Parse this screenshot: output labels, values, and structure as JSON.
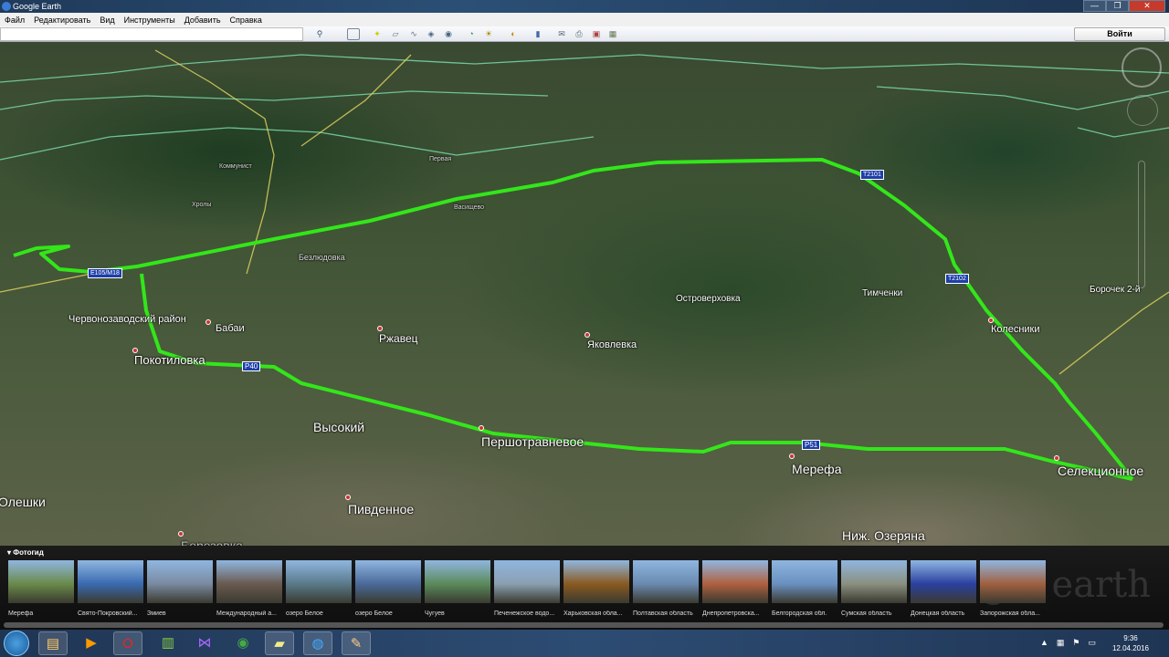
{
  "window": {
    "title": "Google Earth",
    "min": "—",
    "max": "❐",
    "close": "✕"
  },
  "menu": [
    "Файл",
    "Редактировать",
    "Вид",
    "Инструменты",
    "Добавить",
    "Справка"
  ],
  "toolbar": {
    "search_value": "",
    "login": "Войти"
  },
  "map": {
    "route_color": "#33e61a",
    "places": {
      "chervonozavodsky": "Червонозаводский район",
      "babai": "Бабаи",
      "bezlyudovka": "Безлюдовка",
      "pokotilovka": "Покотиловка",
      "rzhavets": "Ржавец",
      "vysokiy": "Высокий",
      "pershotravnevoe": "Першотравневое",
      "pivdennoe": "Пивденное",
      "merefa": "Мерефа",
      "nizh_ozeryana": "Ниж. Озеряна",
      "selektsionnoe": "Селекционное",
      "yakovlevka": "Яковлевка",
      "ostroverkhovka": "Островерховка",
      "timchenki": "Тимченки",
      "kolesniki": "Колесники",
      "borochek": "Борочек 2-й",
      "oleshki": "Олешки",
      "berezovka": "Березовка",
      "vasischevo": "Васищево",
      "khroly": "Хролы",
      "kommunist": "Коммунист",
      "pervaya": "Первая"
    },
    "roads": {
      "r51": "Р51",
      "r40": "Р40",
      "m18": "Е105/М18",
      "t2102": "Т2102",
      "t2101": "Т2101"
    }
  },
  "photos": {
    "header": "Фотогид",
    "watermark": "gle earth",
    "items": [
      {
        "caption": "Мерефа",
        "color": "#6a8a4a"
      },
      {
        "caption": "Свято-Покровский...",
        "color": "#3a6ab0"
      },
      {
        "caption": "Змиев",
        "color": "#7a8aa0"
      },
      {
        "caption": "Международный а...",
        "color": "#6a5a50"
      },
      {
        "caption": "озеро Белое",
        "color": "#5a7a8a"
      },
      {
        "caption": "озеро Белое",
        "color": "#4a6a9a"
      },
      {
        "caption": "Чугуев",
        "color": "#5a8a5a"
      },
      {
        "caption": "Печенежское водо...",
        "color": "#8aa0b0"
      },
      {
        "caption": "Харьковская обла...",
        "color": "#8a5a20"
      },
      {
        "caption": "Полтавская область",
        "color": "#6a8ab0"
      },
      {
        "caption": "Днепропетровска...",
        "color": "#b06040"
      },
      {
        "caption": "Белгородская обл.",
        "color": "#6a90c0"
      },
      {
        "caption": "Сумская область",
        "color": "#8a9080"
      },
      {
        "caption": "Донецкая область",
        "color": "#2a40a0"
      },
      {
        "caption": "Запорожская обла...",
        "color": "#a06040"
      }
    ]
  },
  "taskbar": {
    "time": "9:36",
    "date": "12.04.2016",
    "tray_arrow": "▲"
  }
}
